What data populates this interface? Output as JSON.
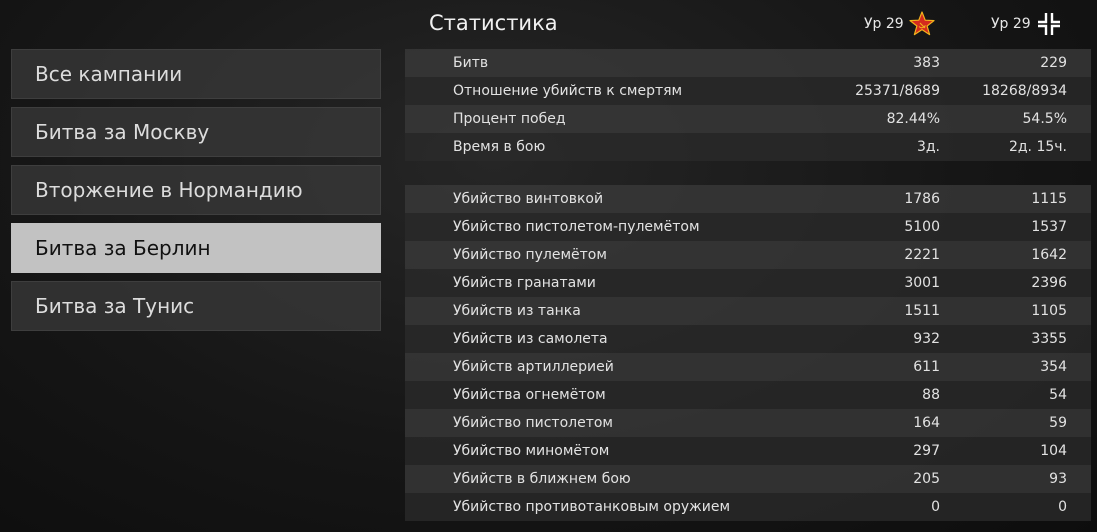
{
  "menu": {
    "items": [
      {
        "label": "Все кампании"
      },
      {
        "label": "Битва за Москву"
      },
      {
        "label": "Вторжение в Нормандию"
      },
      {
        "label": "Битва за Берлин",
        "active": true
      },
      {
        "label": "Битва за Тунис"
      }
    ]
  },
  "header": {
    "title": "Статистика",
    "soviet": {
      "level": "Ур 29",
      "icon": "soviet-star-icon"
    },
    "german": {
      "level": "Ур 29",
      "icon": "german-cross-icon"
    }
  },
  "summary_rows": [
    {
      "label": "Битв",
      "soviet": "383",
      "german": "229"
    },
    {
      "label": "Отношение убийств к смертям",
      "soviet": "25371/8689",
      "german": "18268/8934"
    },
    {
      "label": "Процент побед",
      "soviet": "82.44%",
      "german": "54.5%"
    },
    {
      "label": "Время в бою",
      "soviet": "3д.",
      "german": "2д. 15ч."
    }
  ],
  "kill_rows": [
    {
      "label": "Убийство винтовкой",
      "soviet": "1786",
      "german": "1115"
    },
    {
      "label": "Убийство пистолетом-пулемётом",
      "soviet": "5100",
      "german": "1537"
    },
    {
      "label": "Убийство пулемётом",
      "soviet": "2221",
      "german": "1642"
    },
    {
      "label": "Убийств гранатами",
      "soviet": "3001",
      "german": "2396"
    },
    {
      "label": "Убийств из танка",
      "soviet": "1511",
      "german": "1105"
    },
    {
      "label": "Убийств из самолета",
      "soviet": "932",
      "german": "3355"
    },
    {
      "label": "Убийств артиллерией",
      "soviet": "611",
      "german": "354"
    },
    {
      "label": "Убийства огнемётом",
      "soviet": "88",
      "german": "54"
    },
    {
      "label": "Убийство пистолетом",
      "soviet": "164",
      "german": "59"
    },
    {
      "label": "Убийство миномётом",
      "soviet": "297",
      "german": "104"
    },
    {
      "label": "Убийств в ближнем бою",
      "soviet": "205",
      "german": "93"
    },
    {
      "label": "Убийство противотанковым оружием",
      "soviet": "0",
      "german": "0"
    }
  ],
  "colors": {
    "soviet_star": "#d42a1e",
    "soviet_star_edge": "#f2b21c",
    "active_menu_bg": "#c2c2c2"
  }
}
